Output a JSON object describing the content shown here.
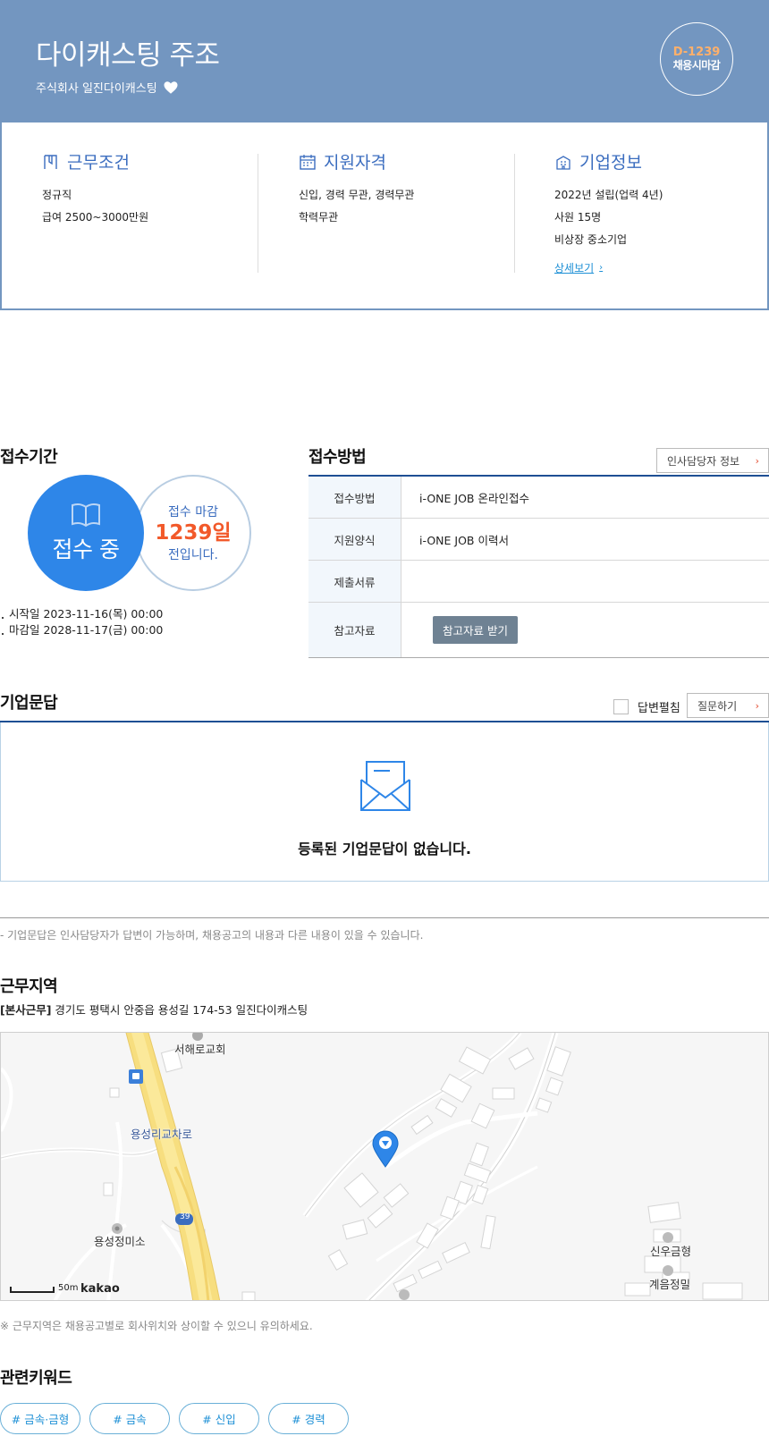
{
  "header": {
    "title": "다이캐스팅 주조",
    "company": "주식회사 일진다이캐스팅",
    "dday": "D-1239",
    "dday_status": "채용시마감"
  },
  "info": {
    "work": {
      "title": "근무조건",
      "lines": [
        "정규직",
        "급여 2500~3000만원"
      ]
    },
    "qual": {
      "title": "지원자격",
      "lines": [
        "신입, 경력 무관, 경력무관",
        "학력무관"
      ]
    },
    "corp": {
      "title": "기업정보",
      "lines": [
        "2022년 설립(업력 4년)",
        "사원 15명",
        "비상장 중소기업"
      ],
      "more": "상세보기"
    }
  },
  "period": {
    "title": "접수기간",
    "status": "접수 중",
    "remain_prefix": "접수 마감",
    "remain_days": "1239일",
    "remain_suffix": "전입니다.",
    "start": "시작일 2023-11-16(목) 00:00",
    "end": "마감일 2028-11-17(금) 00:00"
  },
  "method": {
    "title": "접수방법",
    "contact_button": "인사담당자 정보",
    "rows": [
      {
        "key": "접수방법",
        "value": "i-ONE JOB 온라인접수"
      },
      {
        "key": "지원양식",
        "value": "i-ONE JOB 이력서"
      },
      {
        "key": "제출서류",
        "value": ""
      },
      {
        "key": "참고자료",
        "button": "참고자료 받기"
      }
    ]
  },
  "qna": {
    "title": "기업문답",
    "expand_label": "답변펼침",
    "ask_button": "질문하기",
    "empty": "등록된 기업문답이 없습니다.",
    "note": "- 기업문답은 인사담당자가 답변이 가능하며, 채용공고의 내용과 다른 내용이 있을 수 있습니다."
  },
  "location": {
    "title": "근무지역",
    "tag": "[본사근무]",
    "address": "경기도 평택시 안중읍 용성길 174-53 일진다이캐스팅",
    "map_labels": [
      "서해로교회",
      "용성리교차로",
      "용성정미소",
      "신우금형",
      "계음정밀",
      "39"
    ],
    "scale": "50m",
    "brand": "kakao",
    "note": "※ 근무지역은 채용공고별로 회사위치와 상이할 수 있으니 유의하세요."
  },
  "keywords": {
    "title": "관련키워드",
    "items": [
      "# 금속·금형",
      "# 금속",
      "# 신입",
      "# 경력"
    ]
  },
  "colors": {
    "header": "#7396c0",
    "accent": "#2e86e8",
    "dday": "#ffb06a",
    "remain": "#f2592a"
  }
}
